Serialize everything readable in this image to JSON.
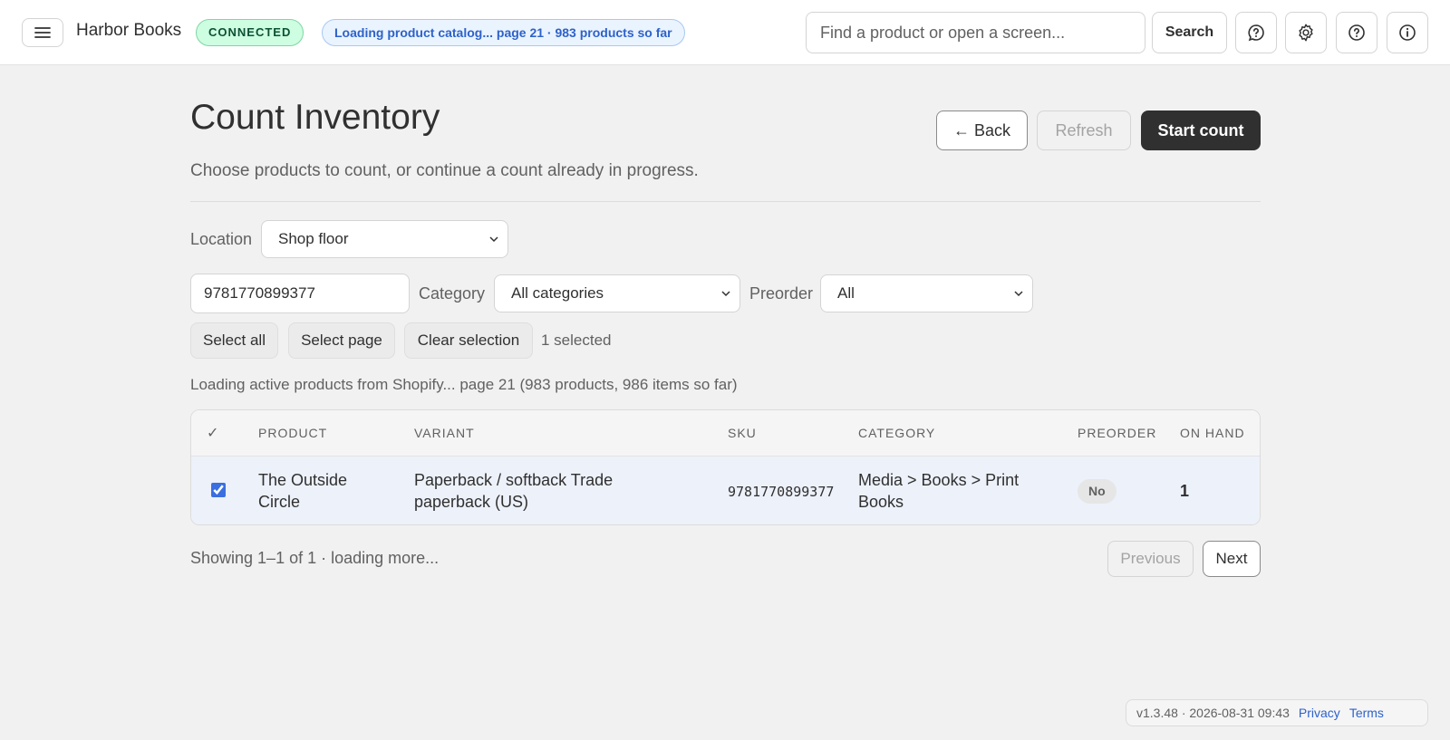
{
  "app": {
    "name": "Harbor Books",
    "connection_status": "CONNECTED",
    "loading_banner": "Loading product catalog... page 21 · 983 products so far"
  },
  "search": {
    "placeholder": "Find a product or open a screen...",
    "button_label": "Search"
  },
  "header_icons": [
    "feedback-icon",
    "gear-icon",
    "help-icon",
    "info-icon"
  ],
  "page": {
    "title": "Count Inventory",
    "subtitle": "Choose products to count, or continue a count already in progress.",
    "back_label": "← Back",
    "refresh_label": "Refresh",
    "start_label": "Start count"
  },
  "filters": {
    "location_label": "Location",
    "location_value": "Shop floor",
    "sku_value": "9781770899377",
    "category_label": "Category",
    "category_value": "All categories",
    "preorder_label": "Preorder",
    "preorder_value": "All"
  },
  "selection": {
    "select_all": "Select all",
    "select_page": "Select page",
    "clear": "Clear selection",
    "count_text": "1 selected"
  },
  "status_text": "Loading active products from Shopify... page 21 (983 products, 986 items so far)",
  "table": {
    "headers": {
      "check": "✓",
      "product": "PRODUCT",
      "variant": "VARIANT",
      "sku": "SKU",
      "category": "CATEGORY",
      "preorder": "PREORDER",
      "on_hand": "ON HAND"
    },
    "rows": [
      {
        "checked": true,
        "product_line1": "The Outside",
        "product_line2": "Circle",
        "variant_line1": "Paperback / softback Trade",
        "variant_line2": "paperback (US)",
        "sku": "9781770899377",
        "category_line1": "Media > Books > Print",
        "category_line2": "Books",
        "preorder": "No",
        "on_hand": "1"
      }
    ]
  },
  "pagination": {
    "showing_text": "Showing 1–1 of 1 · loading more...",
    "previous_label": "Previous",
    "next_label": "Next"
  },
  "footer": {
    "version_text": "v1.3.48 · 2026-08-31 09:43",
    "privacy_label": "Privacy",
    "terms_label": "Terms"
  },
  "colors": {
    "primary_button": "#303030",
    "connected_bg": "#cdfee1",
    "loading_badge_text": "#2e62c9",
    "selected_row_bg": "#edf1fa",
    "link": "#2e62c9"
  }
}
